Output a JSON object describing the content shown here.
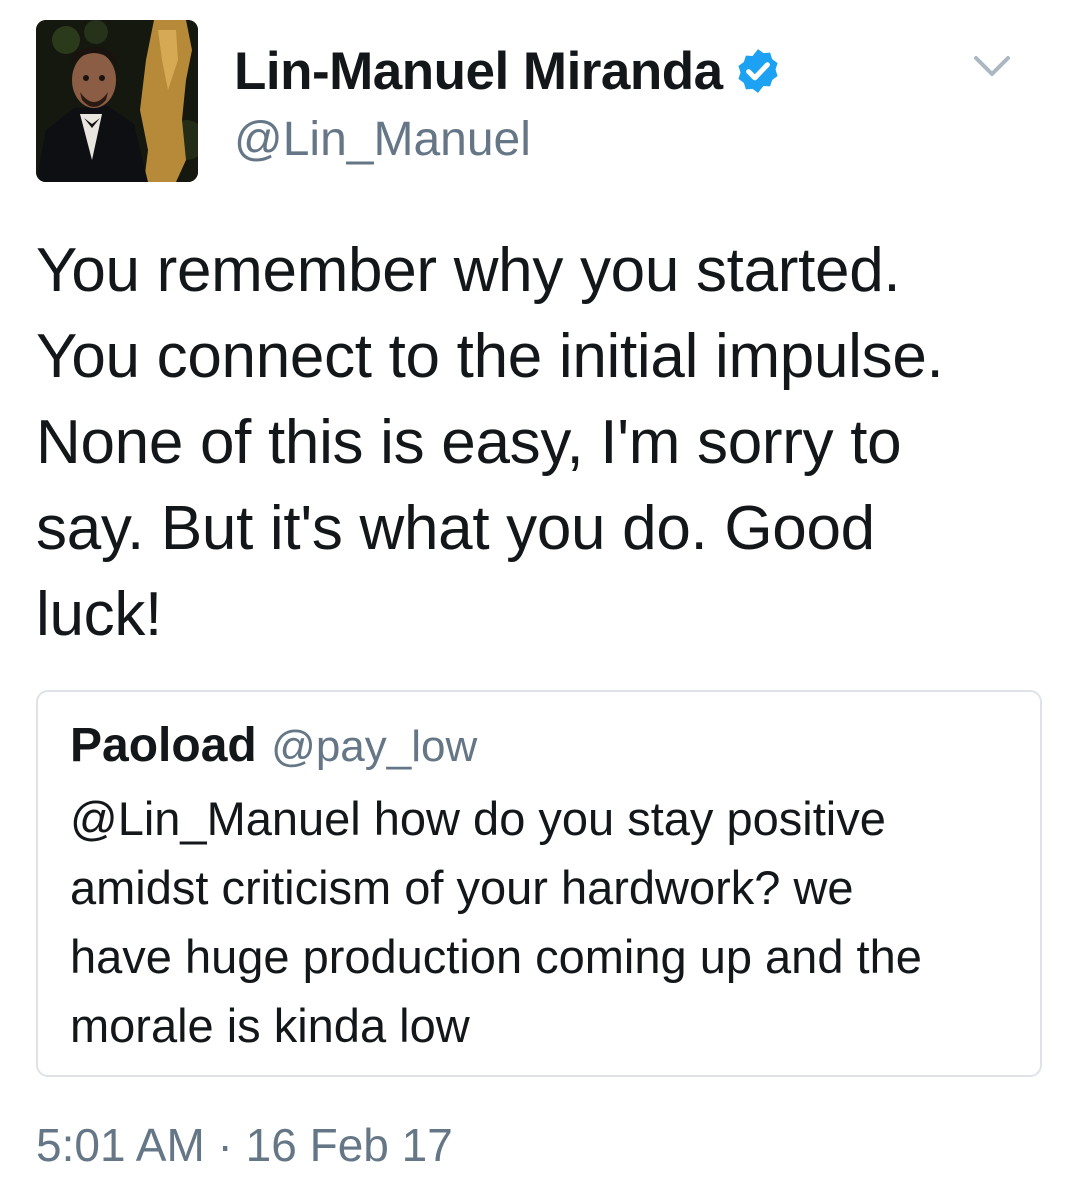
{
  "tweet": {
    "author": {
      "display_name": "Lin-Manuel Miranda",
      "handle": "@Lin_Manuel",
      "verified": true,
      "verified_color": "#1da1f2"
    },
    "text_lines": [
      "You remember why you started.",
      "You connect to the initial impulse.",
      "None of this is easy, I'm sorry to",
      "say. But it's what you do. Good",
      "luck!"
    ],
    "quoted_tweet": {
      "display_name": "Paoload",
      "handle": "@pay_low",
      "text_lines": [
        "@Lin_Manuel how do you stay positive",
        "amidst criticism of your hardwork? we",
        "have huge production coming up and the",
        "morale is kinda low"
      ]
    },
    "timestamp": "5:01 AM · 16 Feb 17",
    "icons": {
      "menu": "chevron-down-icon",
      "verified": "verified-badge-icon"
    }
  }
}
